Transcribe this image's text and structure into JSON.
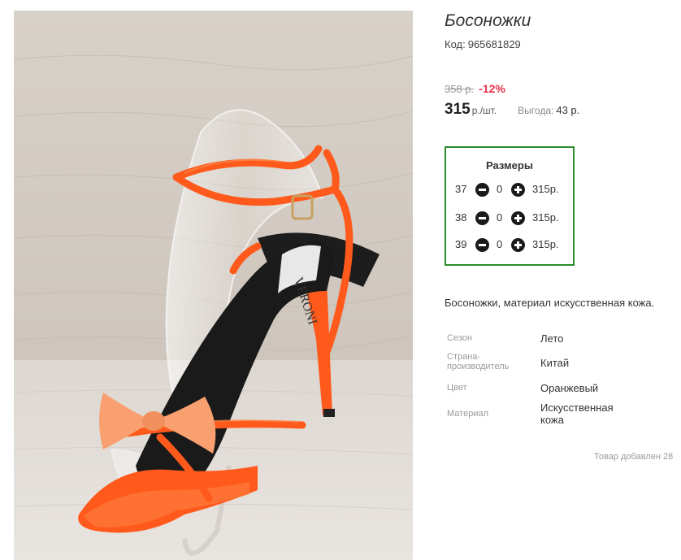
{
  "product": {
    "title": "Босоножки",
    "code_label": "Код:",
    "code_value": "965681829",
    "old_price": "358 р.",
    "discount": "-12%",
    "price": "315",
    "price_unit": "р./шт.",
    "benefit_label": "Выгода:",
    "benefit_value": "43 р.",
    "insole_brand": "VERONI",
    "description": "Босоножки, материал искусственная кожа.",
    "added": "Товар добавлен 28"
  },
  "sizes": {
    "title": "Размеры",
    "rows": [
      {
        "size": "37",
        "qty": "0",
        "price": "315р."
      },
      {
        "size": "38",
        "qty": "0",
        "price": "315р."
      },
      {
        "size": "39",
        "qty": "0",
        "price": "315р."
      }
    ]
  },
  "properties": [
    {
      "label": "Сезон",
      "value": "Лето"
    },
    {
      "label": "Страна-производитель",
      "value": "Китай"
    },
    {
      "label": "Цвет",
      "value": "Оранжевый"
    },
    {
      "label": "Материал",
      "value": "Искусственная кожа"
    }
  ],
  "colors": {
    "accent_discount": "#e8334a",
    "sizes_border": "#2b8a2b",
    "shoe": "#ff6a2c"
  },
  "icons": {
    "minus": "minus-circle-icon",
    "plus": "plus-circle-icon"
  }
}
